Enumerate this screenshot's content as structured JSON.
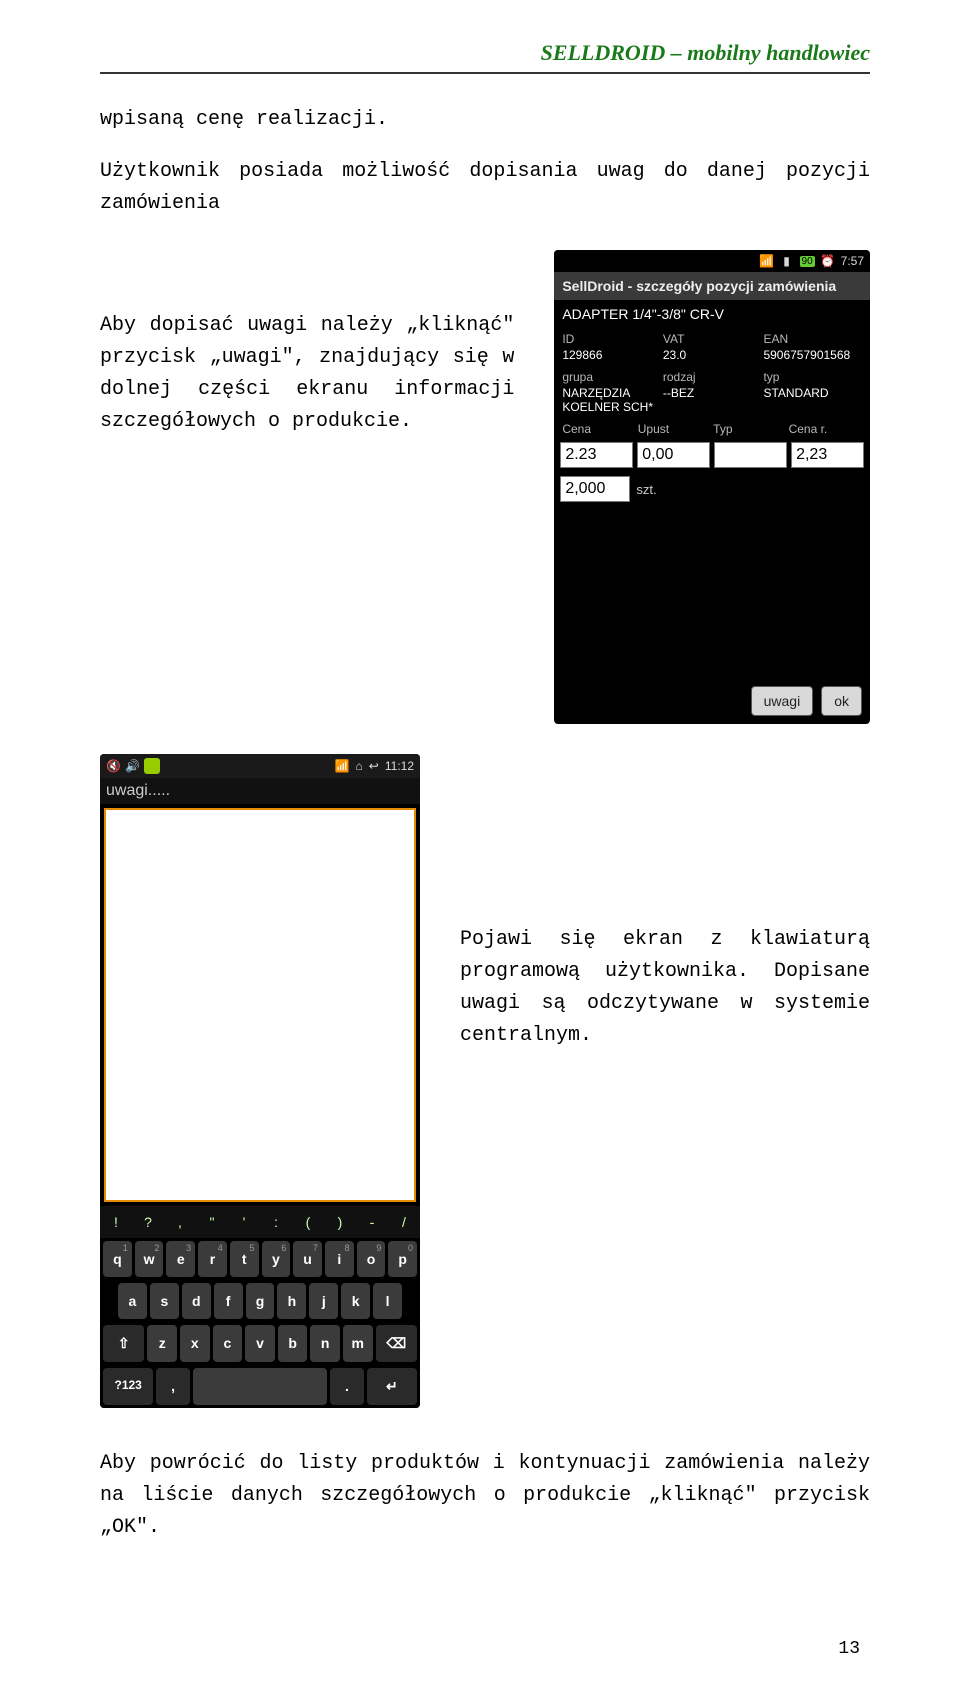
{
  "header": "SELLDROID – mobilny handlowiec",
  "p1": "wpisaną cenę realizacji.",
  "p2": "Użytkownik posiada możliwość dopisania uwag do danej pozycji zamówienia",
  "p3": "Aby dopisać uwagi należy „kliknąć\" przycisk „uwagi\", znajdujący się w dolnej części ekranu informacji szczegółowych o produkcie.",
  "p4": "Pojawi się ekran z klawiaturą programową użytkownika. Dopisane uwagi są odczytywane w systemie centralnym.",
  "p5": "Aby powrócić do listy produktów i kontynuacji zamówienia należy na liście danych szczegółowych o produkcie „kliknąć\" przycisk „OK\".",
  "page_num": "13",
  "phone1": {
    "time": "7:57",
    "battery": "90",
    "title": "SellDroid - szczegóły pozycji zamówienia",
    "product": "ADAPTER 1/4\"-3/8\" CR-V",
    "row1_labels": [
      "ID",
      "VAT",
      "EAN"
    ],
    "row1_values": [
      "129866",
      "23.0",
      "5906757901568"
    ],
    "row2_labels": [
      "grupa",
      "rodzaj",
      "typ"
    ],
    "row2_values": [
      "NARZĘDZIA KOELNER SCH*",
      "--BEZ",
      "STANDARD"
    ],
    "row3_labels": [
      "Cena",
      "Upust",
      "Typ",
      "Cena r."
    ],
    "inputs": [
      "2.23",
      "0,00",
      "",
      "2,23"
    ],
    "qty": "2,000",
    "qty_unit": "szt.",
    "btn_uwagi": "uwagi",
    "btn_ok": "ok"
  },
  "phone2": {
    "time": "11:12",
    "label": "uwagi.....",
    "symbols": [
      "!",
      "?",
      ",",
      "\"",
      "'",
      ":",
      "(",
      ")",
      "-",
      "/"
    ],
    "row_q": [
      [
        "q",
        "1"
      ],
      [
        "w",
        "2"
      ],
      [
        "e",
        "3"
      ],
      [
        "r",
        "4"
      ],
      [
        "t",
        "5"
      ],
      [
        "y",
        "6"
      ],
      [
        "u",
        "7"
      ],
      [
        "i",
        "8"
      ],
      [
        "o",
        "9"
      ],
      [
        "p",
        "0"
      ]
    ],
    "row_a": [
      "a",
      "s",
      "d",
      "f",
      "g",
      "h",
      "j",
      "k",
      "l"
    ],
    "row_z": [
      "z",
      "x",
      "c",
      "v",
      "b",
      "n",
      "m"
    ],
    "key_shift": "⇧",
    "key_bksp": "⌫",
    "key_123": "?123",
    "key_comma": ",",
    "key_dot": ".",
    "key_enter": "↵"
  }
}
